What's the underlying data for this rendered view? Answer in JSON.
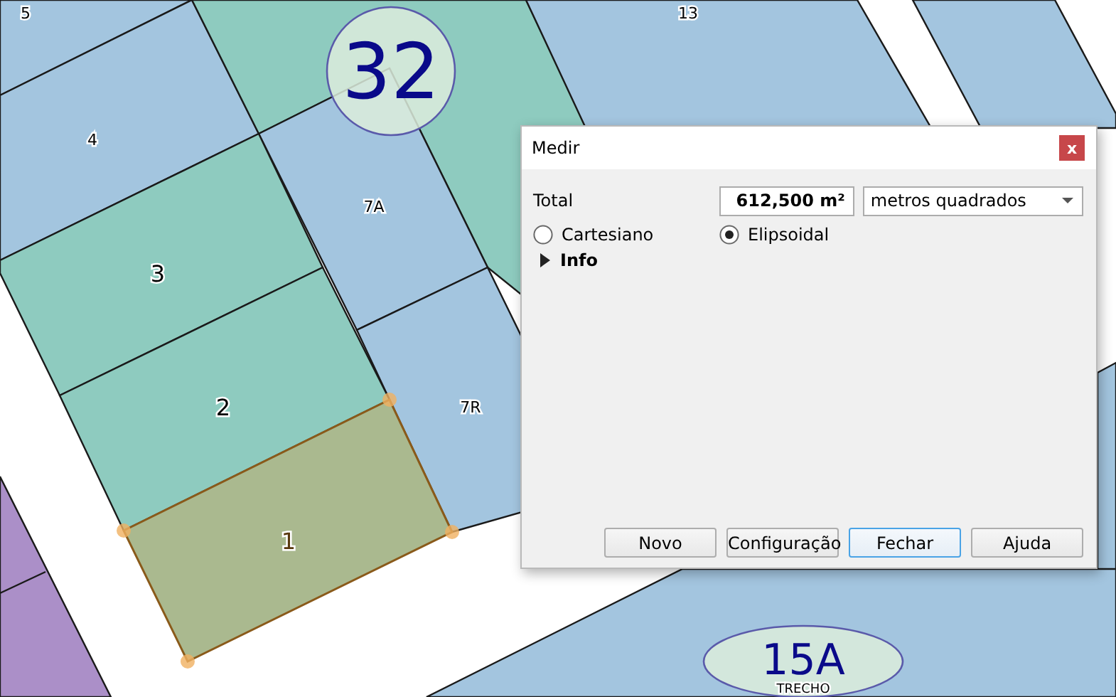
{
  "map": {
    "lot_labels": [
      "5",
      "13",
      "4",
      "7A",
      "3",
      "2",
      "7R",
      "1"
    ],
    "block_labels": [
      {
        "text": "32"
      },
      {
        "text": "15A",
        "sublabel": "TRECHO"
      }
    ]
  },
  "dialog": {
    "title": "Medir",
    "close": "x",
    "total_label": "Total",
    "total_value": "612,500 m²",
    "unit": "metros quadrados",
    "methods": [
      {
        "label": "Cartesiano",
        "selected": false
      },
      {
        "label": "Elipsoidal",
        "selected": true
      }
    ],
    "info": {
      "label": "Info",
      "expanded": false
    },
    "buttons": [
      {
        "label": "Novo",
        "focused": false
      },
      {
        "label": "Configuração",
        "focused": false
      },
      {
        "label": "Fechar",
        "focused": true
      },
      {
        "label": "Ajuda",
        "focused": false
      }
    ]
  }
}
